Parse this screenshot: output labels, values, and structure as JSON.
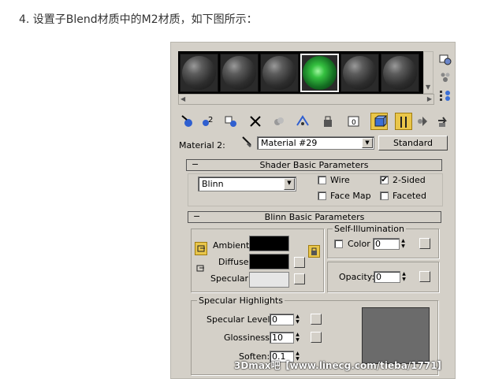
{
  "caption": "4. 设置子Blend材质中的M2材质，如下图所示：",
  "material_row": {
    "label": "Material 2:",
    "name_value": "Material #29",
    "type_button": "Standard"
  },
  "shader_rollout": {
    "title": "Shader Basic Parameters",
    "shader_value": "Blinn",
    "wire": {
      "label": "Wire",
      "checked": false
    },
    "two_sided": {
      "label": "2-Sided",
      "checked": true,
      "mark": "✔"
    },
    "face_map": {
      "label": "Face Map",
      "checked": false
    },
    "faceted": {
      "label": "Faceted",
      "checked": false
    }
  },
  "blinn_rollout": {
    "title": "Blinn Basic Parameters",
    "ambient_label": "Ambient:",
    "diffuse_label": "Diffuse:",
    "specular_label": "Specular:",
    "ambient_color": "#000000",
    "diffuse_color": "#000000",
    "specular_color": "#e6e6e6",
    "self_illum": {
      "title": "Self-Illumination",
      "color_label": "Color",
      "color_checked": false,
      "value": "0"
    },
    "opacity": {
      "label": "Opacity:",
      "value": "0"
    }
  },
  "specular_highlights": {
    "title": "Specular Highlights",
    "level_label": "Specular Level:",
    "level_value": "0",
    "glossiness_label": "Glossiness:",
    "glossiness_value": "10",
    "soften_label": "Soften:",
    "soften_value": "0.1",
    "curve_preview_color": "#6b6b6b"
  },
  "sample_slots": {
    "count": 6,
    "active_index": 3
  },
  "icons": {
    "side": [
      "sample-type-icon",
      "backlight-icon",
      "background-icon"
    ],
    "toolbar": [
      "get-material-icon",
      "put-to-scene-icon",
      "assign-to-selection-icon",
      "reset-map-icon",
      "make-copy-icon",
      "make-unique-icon",
      "put-to-library-icon",
      "material-effects-channel-icon",
      "show-map-in-viewport-icon",
      "show-end-result-icon",
      "go-to-parent-icon",
      "go-forward-to-sibling-icon"
    ]
  },
  "watermark": "3Dmax吧【www.linecg.com/tieba/1771】"
}
